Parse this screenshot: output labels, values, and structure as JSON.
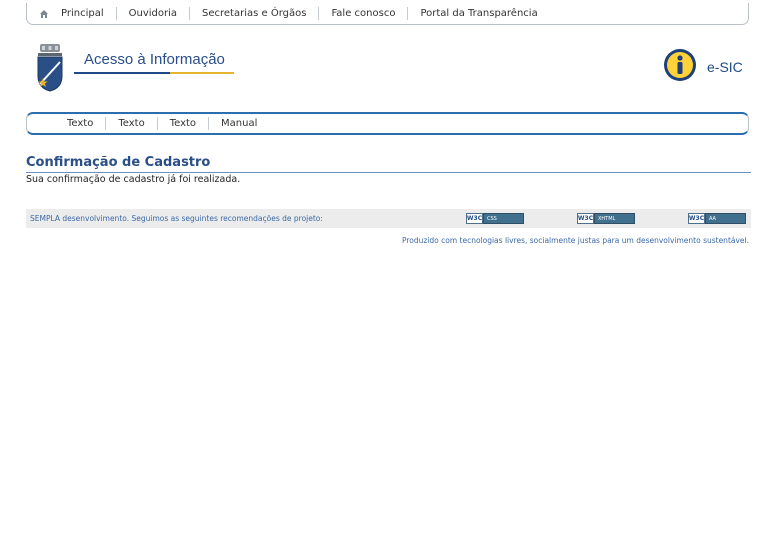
{
  "topnav": {
    "items": [
      "Principal",
      "Ouvidoria",
      "Secretarias e Órgãos",
      "Fale conosco",
      "Portal da Transparência"
    ]
  },
  "header": {
    "brand": "Acesso à Informação",
    "esic_label": "e-SIC"
  },
  "subnav": {
    "items": [
      "Texto",
      "Texto",
      "Texto",
      "Manual"
    ]
  },
  "main": {
    "title": "Confirmação de Cadastro",
    "message": "Sua confirmação de cadastro já foi realizada."
  },
  "footer": {
    "text": "SEMPLA desenvolvimento. Seguimos as seguintes recomendações de projeto:",
    "badges": [
      {
        "w3c": "W3C",
        "label": "CSS"
      },
      {
        "w3c": "W3C",
        "label": "XHTML"
      },
      {
        "w3c": "W3C",
        "label": "AA"
      }
    ],
    "note": "Produzido com tecnologias livres, socialmente justas para um desenvolvimento sustentável."
  },
  "colors": {
    "brand_blue": "#2a4f86",
    "accent_gold": "#e7b431",
    "link_blue": "#3b6aa6"
  }
}
